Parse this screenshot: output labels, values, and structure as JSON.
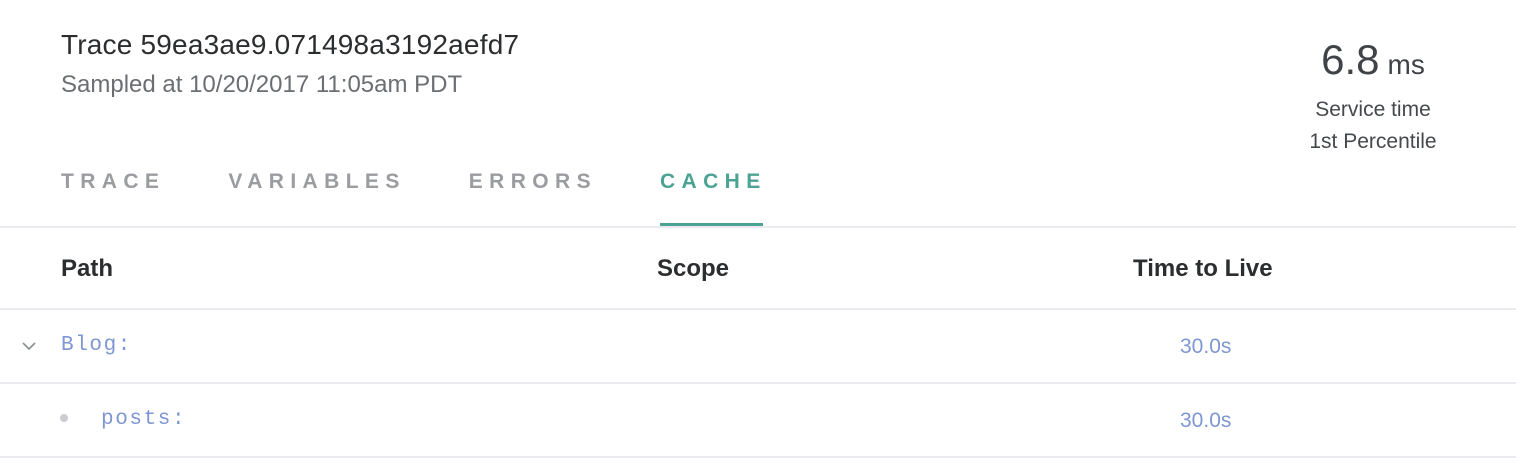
{
  "header": {
    "title": "Trace 59ea3ae9.071498a3192aefd7",
    "sampled_at": "Sampled at 10/20/2017 11:05am PDT"
  },
  "metric": {
    "value": "6.8",
    "unit": "ms",
    "label": "Service time",
    "sublabel": "1st Percentile"
  },
  "tabs": [
    {
      "label": "TRACE",
      "active": false
    },
    {
      "label": "VARIABLES",
      "active": false
    },
    {
      "label": "ERRORS",
      "active": false
    },
    {
      "label": "CACHE",
      "active": true
    }
  ],
  "table": {
    "columns": {
      "path": "Path",
      "scope": "Scope",
      "ttl": "Time to Live"
    },
    "rows": [
      {
        "path": "Blog:",
        "scope": "",
        "ttl": "30.0s",
        "icon": "chevron-down-icon"
      },
      {
        "path": "posts:",
        "scope": "",
        "ttl": "30.0s",
        "icon": "bullet-icon"
      }
    ]
  },
  "colors": {
    "accent": "#4ca393",
    "link": "#7e96d3",
    "muted_tab": "#9a9c9f"
  }
}
